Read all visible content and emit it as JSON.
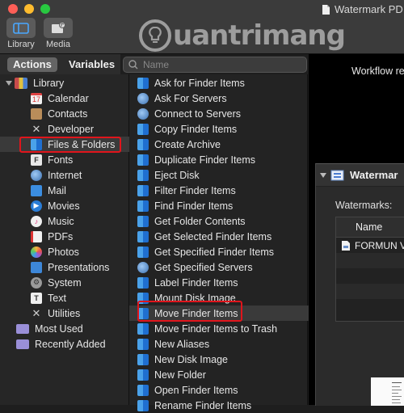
{
  "window": {
    "title": "Watermark PD"
  },
  "toolbar": {
    "library_label": "Library",
    "media_label": "Media"
  },
  "watermark_logo": {
    "text": "uantrimang"
  },
  "tabs": {
    "actions": "Actions",
    "variables": "Variables"
  },
  "search": {
    "placeholder": "Name",
    "value": ""
  },
  "library": {
    "root": "Library",
    "items": [
      {
        "label": "Calendar",
        "icon": "calendar-icon"
      },
      {
        "label": "Contacts",
        "icon": "contacts-icon"
      },
      {
        "label": "Developer",
        "icon": "developer-icon"
      },
      {
        "label": "Files & Folders",
        "icon": "finder-icon",
        "selected": true
      },
      {
        "label": "Fonts",
        "icon": "fonts-icon"
      },
      {
        "label": "Internet",
        "icon": "globe-icon"
      },
      {
        "label": "Mail",
        "icon": "mail-icon"
      },
      {
        "label": "Movies",
        "icon": "movies-icon"
      },
      {
        "label": "Music",
        "icon": "music-icon"
      },
      {
        "label": "PDFs",
        "icon": "pdf-icon"
      },
      {
        "label": "Photos",
        "icon": "photos-icon"
      },
      {
        "label": "Presentations",
        "icon": "presentations-icon"
      },
      {
        "label": "System",
        "icon": "system-icon"
      },
      {
        "label": "Text",
        "icon": "text-icon"
      },
      {
        "label": "Utilities",
        "icon": "utilities-icon"
      }
    ],
    "extras": [
      {
        "label": "Most Used",
        "icon": "most-used-folder-icon"
      },
      {
        "label": "Recently Added",
        "icon": "recently-added-folder-icon"
      }
    ]
  },
  "actions": [
    {
      "label": "Ask for Finder Items",
      "icon": "finder-icon"
    },
    {
      "label": "Ask For Servers",
      "icon": "globe-icon"
    },
    {
      "label": "Connect to Servers",
      "icon": "globe-icon"
    },
    {
      "label": "Copy Finder Items",
      "icon": "finder-icon"
    },
    {
      "label": "Create Archive",
      "icon": "finder-icon"
    },
    {
      "label": "Duplicate Finder Items",
      "icon": "finder-icon"
    },
    {
      "label": "Eject Disk",
      "icon": "finder-icon"
    },
    {
      "label": "Filter Finder Items",
      "icon": "finder-icon"
    },
    {
      "label": "Find Finder Items",
      "icon": "finder-icon"
    },
    {
      "label": "Get Folder Contents",
      "icon": "finder-icon"
    },
    {
      "label": "Get Selected Finder Items",
      "icon": "finder-icon"
    },
    {
      "label": "Get Specified Finder Items",
      "icon": "finder-icon"
    },
    {
      "label": "Get Specified Servers",
      "icon": "globe-icon"
    },
    {
      "label": "Label Finder Items",
      "icon": "finder-icon"
    },
    {
      "label": "Mount Disk Image",
      "icon": "finder-icon"
    },
    {
      "label": "Move Finder Items",
      "icon": "finder-icon",
      "highlighted": true
    },
    {
      "label": "Move Finder Items to Trash",
      "icon": "finder-icon"
    },
    {
      "label": "New Aliases",
      "icon": "finder-icon"
    },
    {
      "label": "New Disk Image",
      "icon": "finder-icon"
    },
    {
      "label": "New Folder",
      "icon": "finder-icon"
    },
    {
      "label": "Open Finder Items",
      "icon": "finder-icon"
    },
    {
      "label": "Rename Finder Items",
      "icon": "finder-icon"
    }
  ],
  "workflow": {
    "hint": "Workflow rec",
    "card_title": "Watermar",
    "watermarks_label": "Watermarks:",
    "table_header": "Name",
    "file_name": "FORMUN VI"
  },
  "colors": {
    "selection_outline": "#e0151c",
    "background": "#1e1e1e"
  }
}
